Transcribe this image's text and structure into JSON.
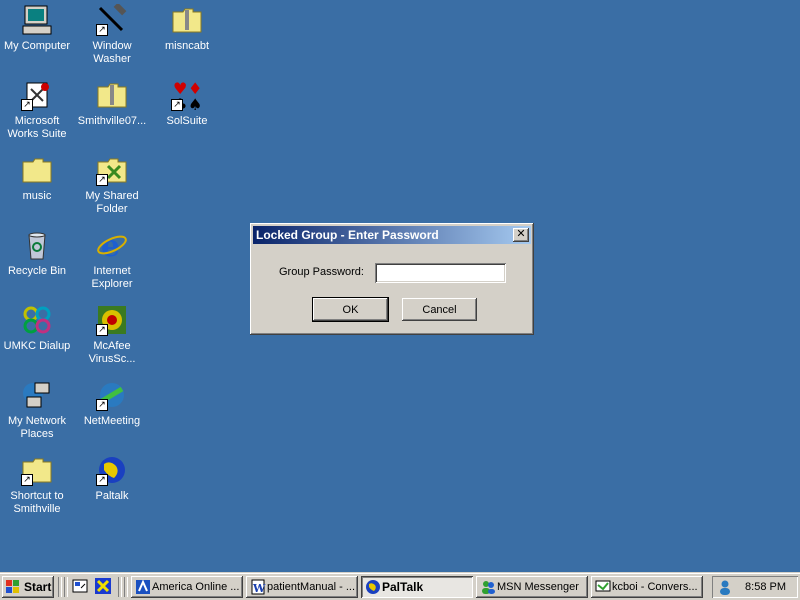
{
  "desktop": {
    "icons": [
      {
        "label": "My Computer",
        "icon": "my-computer-icon"
      },
      {
        "label": "Window Washer",
        "icon": "window-washer-icon"
      },
      {
        "label": "misncabt",
        "icon": "zip-folder-icon"
      },
      {
        "label": "Microsoft Works Suite",
        "icon": "works-suite-icon"
      },
      {
        "label": "Smithville07...",
        "icon": "zip-folder-icon"
      },
      {
        "label": "SolSuite",
        "icon": "card-suits-icon"
      },
      {
        "label": "music",
        "icon": "folder-icon"
      },
      {
        "label": "My Shared Folder",
        "icon": "shared-folder-icon"
      },
      {
        "label": "Recycle Bin",
        "icon": "recycle-bin-icon"
      },
      {
        "label": "Internet Explorer",
        "icon": "internet-explorer-icon"
      },
      {
        "label": "UMKC Dialup",
        "icon": "dialup-icon"
      },
      {
        "label": "McAfee VirusSc...",
        "icon": "mcafee-icon"
      },
      {
        "label": "My Network Places",
        "icon": "network-places-icon"
      },
      {
        "label": "NetMeeting",
        "icon": "netmeeting-icon"
      },
      {
        "label": "Shortcut to Smithville",
        "icon": "folder-icon"
      },
      {
        "label": "Paltalk",
        "icon": "paltalk-globe-icon"
      }
    ]
  },
  "dialog": {
    "title": "Locked Group - Enter Password",
    "close_label": "✕",
    "password_label": "Group Password:",
    "password_value": "",
    "ok_label": "OK",
    "cancel_label": "Cancel"
  },
  "taskbar": {
    "start_label": "Start",
    "tasks": [
      {
        "label": "America  Online ...",
        "icon": "aol-icon",
        "active": false
      },
      {
        "label": "patientManual - ...",
        "icon": "word-doc-icon",
        "active": false
      },
      {
        "label": "PalTalk",
        "icon": "paltalk-globe-icon",
        "active": true
      },
      {
        "label": "MSN Messenger",
        "icon": "msn-messenger-icon",
        "active": false
      },
      {
        "label": "kcboi - Convers...",
        "icon": "conversation-icon",
        "active": false
      }
    ],
    "clock": "8:58 PM"
  },
  "colors": {
    "desktop": "#3a6ea5",
    "titlebar_start": "#0a246a",
    "titlebar_end": "#a6caf0",
    "face": "#d4d0c8"
  }
}
